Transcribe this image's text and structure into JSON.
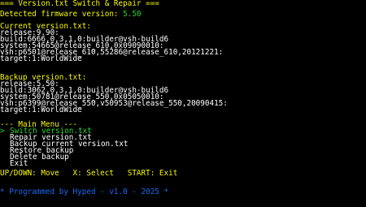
{
  "header": {
    "title": "=== Version.txt Switch & Repair ===",
    "detected_label": "Detected firmware version: ",
    "detected_value": "5.50"
  },
  "current": {
    "heading": "Current version.txt:",
    "lines": [
      "release:9.90:",
      "build:6666,0,3,1,0:builder@vsh-build6",
      "system:54665@release_610,0x09090010:",
      "vsh:p6501@release_610,55286@release_610,20121221:",
      "target:1:WorldWide"
    ]
  },
  "backup": {
    "heading": "Backup version.txt:",
    "lines": [
      "release:5.50:",
      "build:3062,0,3,1,0:builder@vsh-build6",
      "system:50781@release_550,0x05050010:",
      "vsh:p6399@release_550,v50953@release_550,20090415:",
      "target:1:WorldWide"
    ]
  },
  "menu": {
    "heading": "--- Main Menu ---",
    "cursor": ">",
    "items": [
      "Switch version.txt",
      "Repair version.txt",
      "Backup current version.txt",
      "Restore backup",
      "Delete backup",
      "Exit"
    ],
    "selected_index": 0
  },
  "controls": {
    "text": "UP/DOWN: Move   X: Select   START: Exit"
  },
  "footer": {
    "text": "* Programmed by Hyped - v1.0 - 2025 *"
  },
  "colors": {
    "header": "#f8f800",
    "section_heading": "#f8f800",
    "detected_value": "#2ad82a",
    "selected_item": "#2ad82a",
    "body_text": "#ffffff",
    "footer": "#1a6af0",
    "background": "#000000"
  }
}
